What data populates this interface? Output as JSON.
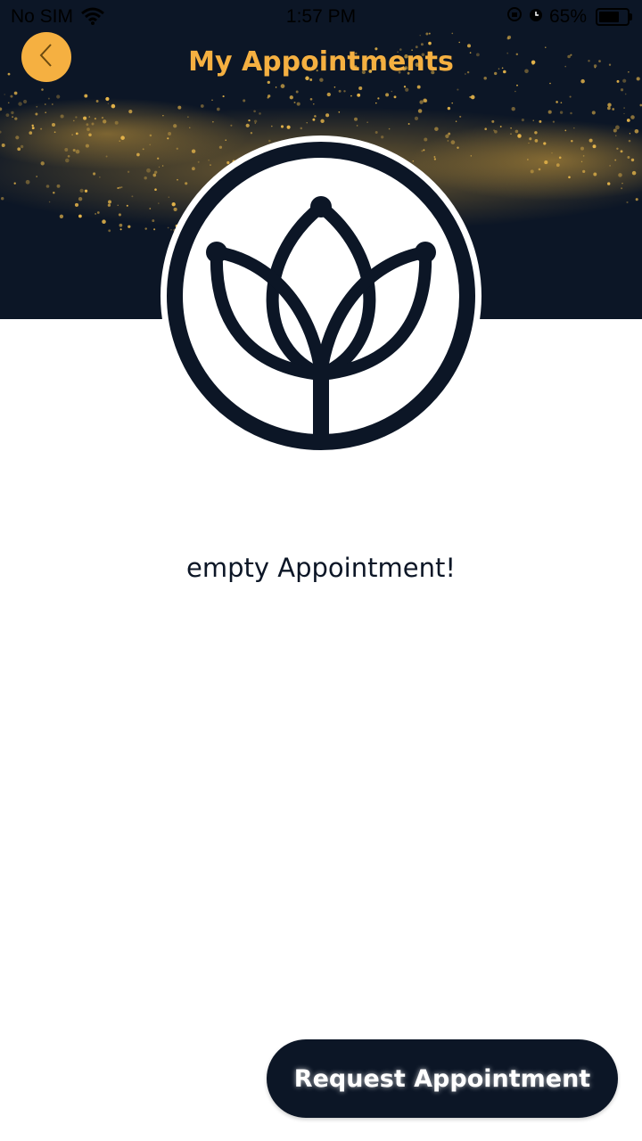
{
  "status_bar": {
    "carrier": "No SIM",
    "time": "1:57 PM",
    "battery": "65%",
    "icons": [
      "wifi-icon",
      "lock-rotation-icon",
      "alarm-icon",
      "battery-icon"
    ]
  },
  "header": {
    "title": "My Appointments",
    "back_icon": "chevron-left-icon"
  },
  "main": {
    "logo": "lotus-logo",
    "empty_message": "empty Appointment!"
  },
  "footer": {
    "request_label": "Request Appointment"
  },
  "colors": {
    "accent": "#f5b041",
    "navy": "#0c1626",
    "background": "#ffffff"
  }
}
